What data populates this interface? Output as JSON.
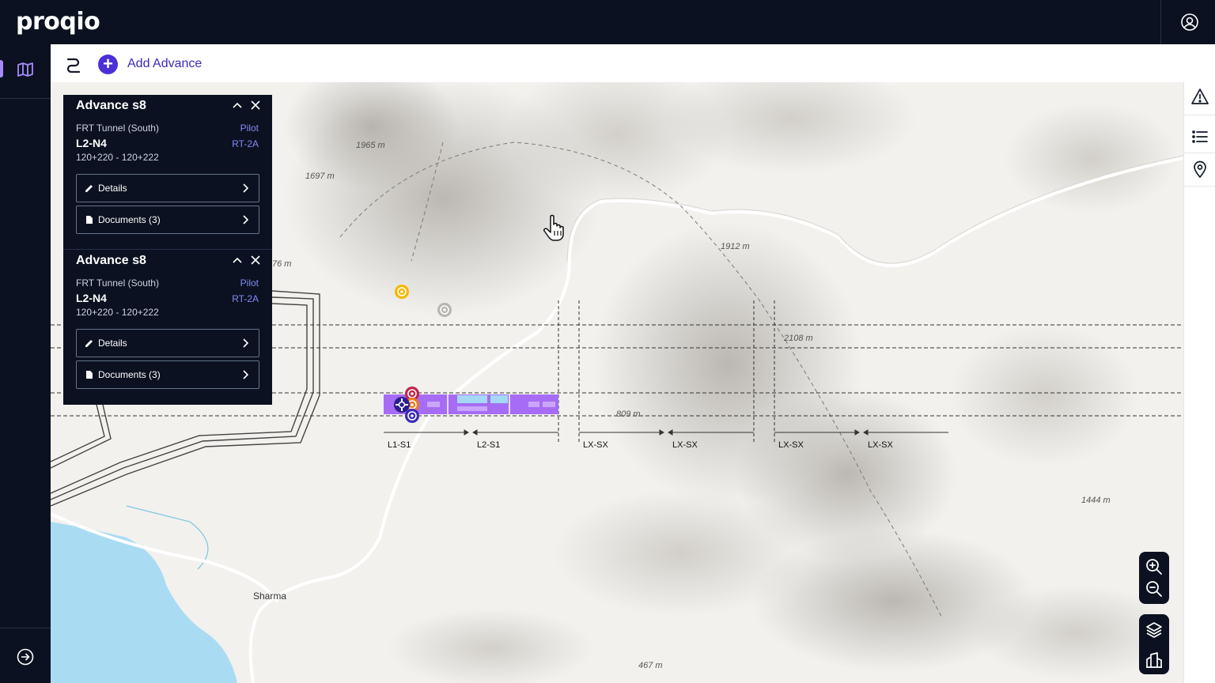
{
  "app": {
    "logo": "proqio"
  },
  "toolbar": {
    "add_label": "Add Advance"
  },
  "panel": {
    "cards": [
      {
        "title": "Advance s8",
        "location": "FRT Tunnel (South)",
        "mode": "Pilot",
        "ring": "L2-N4",
        "rt": "RT-2A",
        "chainage": "120+220 - 120+222",
        "details_label": "Details",
        "documents_label": "Documents (3)"
      },
      {
        "title": "Advance s8",
        "location": "FRT Tunnel (South)",
        "mode": "Pilot",
        "ring": "L2-N4",
        "rt": "RT-2A",
        "chainage": "120+220 - 120+222",
        "details_label": "Details",
        "documents_label": "Documents (3)"
      }
    ]
  },
  "map": {
    "elevations": [
      "1965 m",
      "1697 m",
      "76 m",
      "1912 m",
      "2108 m",
      "809 m",
      "1444 m",
      "467 m"
    ],
    "place": "Sharma",
    "segments": [
      "L1-S1",
      "L2-S1",
      "LX-SX",
      "LX-SX",
      "LX-SX",
      "LX-SX"
    ]
  },
  "colors": {
    "accent": "#4c2fd6",
    "dark": "#0b1120",
    "progress": "#a66cf5",
    "progress_light": "#a5d8f5"
  },
  "icons": [
    "user-icon",
    "map-icon",
    "expand-icon",
    "route-icon",
    "plus-icon",
    "alert-icon",
    "list-icon",
    "location-pin-icon",
    "zoom-in-icon",
    "zoom-out-icon",
    "layers-icon",
    "building-icon",
    "pencil-icon",
    "document-icon",
    "chevron-right-icon",
    "chevron-up-icon",
    "close-icon",
    "hand-pointer-icon"
  ]
}
